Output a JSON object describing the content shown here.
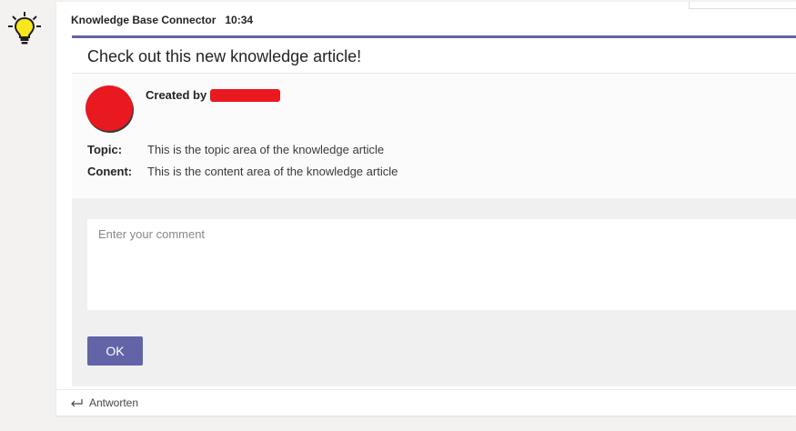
{
  "bot": {
    "avatar_icon": "lightbulb-icon",
    "accent_color": "#f8e71c"
  },
  "message": {
    "sender": "Knowledge Base Connector",
    "timestamp": "10:34"
  },
  "card": {
    "accent_color": "#6264a7",
    "title": "Check out this new knowledge article!",
    "created_by_label": "Created by",
    "author_avatar_color": "#e8191f",
    "facts": [
      {
        "key": "Topic:",
        "value": "This is the topic area of the knowledge article"
      },
      {
        "key": "Conent:",
        "value": "This is the content area of the knowledge article"
      }
    ],
    "comment_placeholder": "Enter your comment",
    "comment_value": "",
    "ok_label": "OK"
  },
  "reply": {
    "icon": "reply-arrow-icon",
    "label": "Antworten"
  }
}
